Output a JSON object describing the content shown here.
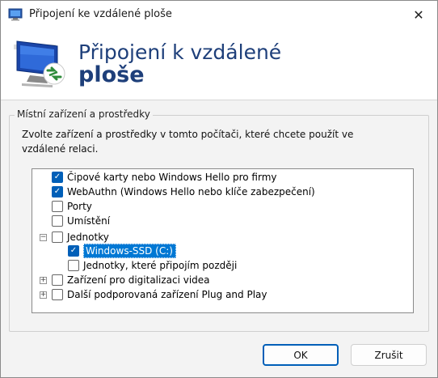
{
  "window": {
    "title": "Připojení ke vzdálené ploše",
    "close_glyph": "✕"
  },
  "banner": {
    "line1": "Připojení k vzdálené",
    "line2": "ploše"
  },
  "group": {
    "label": "Místní zařízení a prostředky",
    "description": "Zvolte zařízení a prostředky v tomto počítači, které chcete použít ve vzdálené relaci."
  },
  "tree": {
    "items": [
      {
        "label": "Čipové karty nebo Windows Hello pro firmy",
        "checked": true
      },
      {
        "label": "WebAuthn (Windows Hello nebo klíče zabezpečení)",
        "checked": true
      },
      {
        "label": "Porty",
        "checked": false
      },
      {
        "label": "Umístění",
        "checked": false
      },
      {
        "label": "Jednotky",
        "checked": false,
        "expander": "−"
      },
      {
        "label": "Windows-SSD (C:)",
        "checked": true,
        "selected": true
      },
      {
        "label": "Jednotky, které připojím později",
        "checked": false
      },
      {
        "label": "Zařízení pro digitalizaci videa",
        "checked": false,
        "expander": "+"
      },
      {
        "label": "Další podporovaná zařízení Plug and Play",
        "checked": false,
        "expander": "+"
      }
    ]
  },
  "buttons": {
    "ok": "OK",
    "cancel": "Zrušit"
  },
  "colors": {
    "accent": "#005fb8",
    "selection": "#0078d4",
    "banner_text": "#1e3f7a"
  }
}
